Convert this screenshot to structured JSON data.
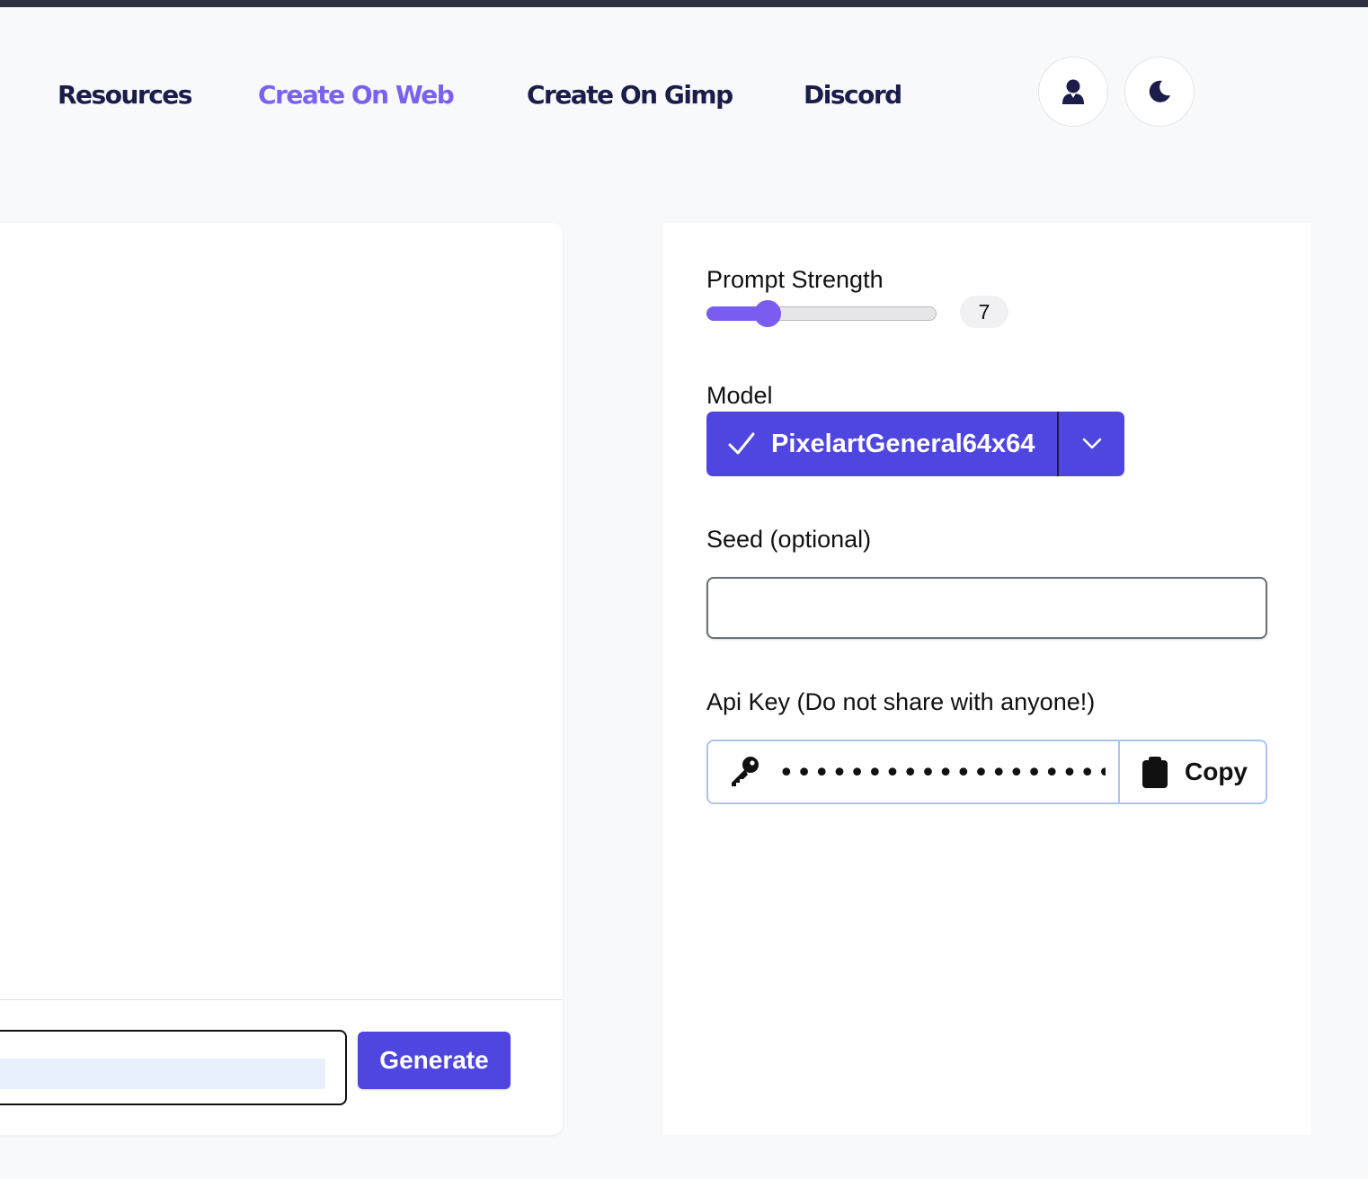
{
  "nav": {
    "links": [
      {
        "label": "Resources",
        "active": false
      },
      {
        "label": "Create On Web",
        "active": true
      },
      {
        "label": "Create On Gimp",
        "active": false
      },
      {
        "label": "Discord",
        "active": false
      }
    ],
    "icons": [
      "user-icon",
      "moon-icon"
    ]
  },
  "prompt": {
    "value": "",
    "generate_label": "Generate"
  },
  "settings": {
    "prompt_strength": {
      "label": "Prompt Strength",
      "value": 7,
      "value_text": "7",
      "min": 0,
      "max": 30
    },
    "model": {
      "label": "Model",
      "selected": "PixelartGeneral64x64"
    },
    "seed": {
      "label": "Seed (optional)",
      "value": ""
    },
    "api_key": {
      "label": "Api Key (Do not share with anyone!)",
      "masked_value": "••••••••••••••••••••••••••••••",
      "copy_label": "Copy"
    }
  },
  "colors": {
    "accent": "#4f46e0",
    "nav_active": "#7b61f0",
    "nav_text": "#1b1c4a",
    "slider": "#7b5cf0",
    "top_strip": "#2d3142"
  }
}
